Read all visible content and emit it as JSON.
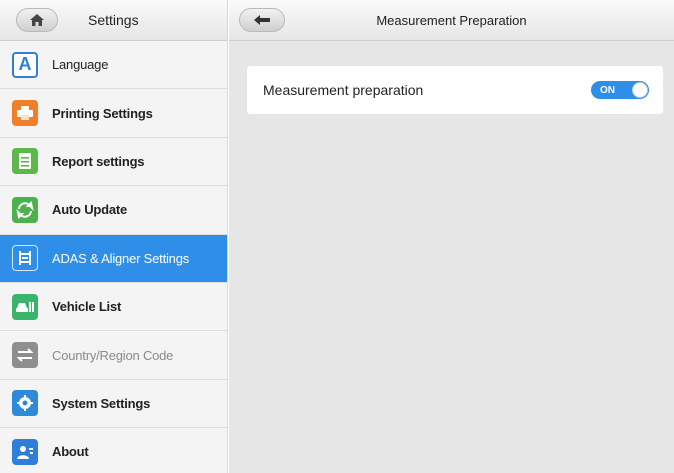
{
  "sidebar": {
    "title": "Settings",
    "items": [
      {
        "label": "Language",
        "icon": "language-icon",
        "color": "#2f7fd8",
        "state": "normal"
      },
      {
        "label": "Printing Settings",
        "icon": "printer-icon",
        "color": "#f07f2a",
        "state": "bold"
      },
      {
        "label": "Report settings",
        "icon": "report-icon",
        "color": "#5db84c",
        "state": "bold"
      },
      {
        "label": "Auto Update",
        "icon": "update-icon",
        "color": "#4cb24c",
        "state": "bold"
      },
      {
        "label": "ADAS & Aligner Settings",
        "icon": "adas-icon",
        "color": "#2f8fe8",
        "state": "active"
      },
      {
        "label": "Vehicle List",
        "icon": "vehicle-list-icon",
        "color": "#39b56a",
        "state": "bold"
      },
      {
        "label": "Country/Region Code",
        "icon": "country-region-icon",
        "color": "#8f8f8f",
        "state": "muted"
      },
      {
        "label": "System Settings",
        "icon": "system-settings-icon",
        "color": "#2c8ad8",
        "state": "bold"
      },
      {
        "label": "About",
        "icon": "about-icon",
        "color": "#2f7fd8",
        "state": "bold"
      }
    ]
  },
  "main": {
    "title": "Measurement Preparation",
    "setting": {
      "label": "Measurement preparation",
      "toggle_text": "ON"
    }
  },
  "colors": {
    "accent": "#2f8fe8",
    "background": "#e6e6e6"
  }
}
